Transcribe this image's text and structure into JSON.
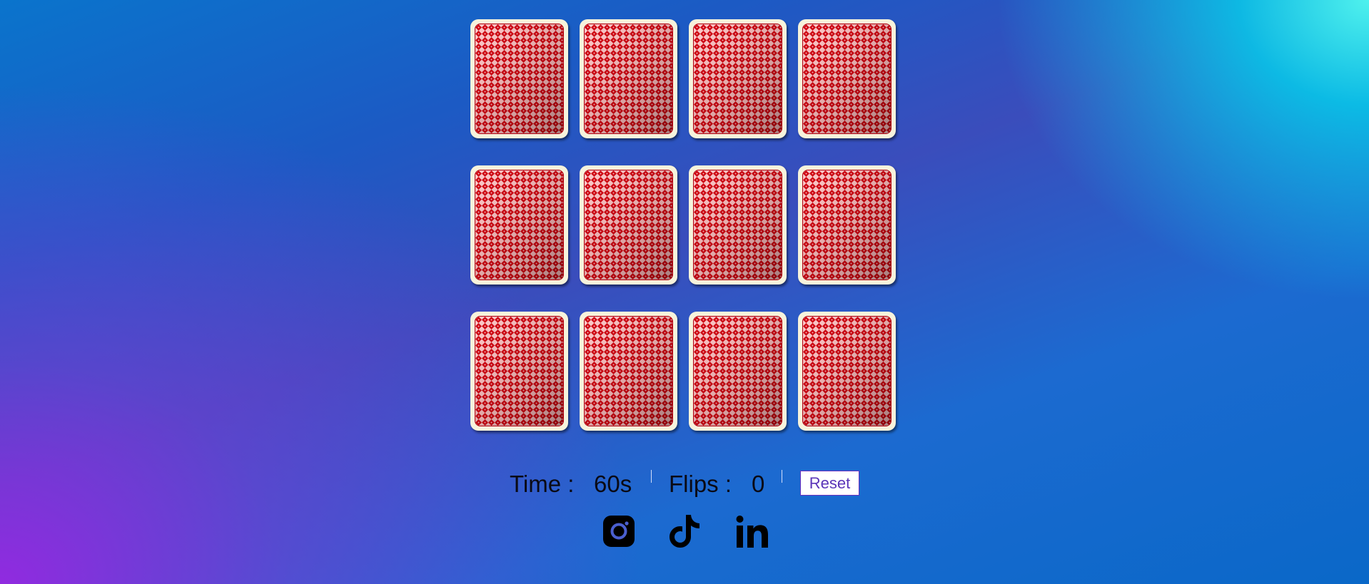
{
  "game": {
    "cards": [
      {
        "id": 1,
        "state": "face-down"
      },
      {
        "id": 2,
        "state": "face-down"
      },
      {
        "id": 3,
        "state": "face-down"
      },
      {
        "id": 4,
        "state": "face-down"
      },
      {
        "id": 5,
        "state": "face-down"
      },
      {
        "id": 6,
        "state": "face-down"
      },
      {
        "id": 7,
        "state": "face-down"
      },
      {
        "id": 8,
        "state": "face-down"
      },
      {
        "id": 9,
        "state": "face-down"
      },
      {
        "id": 10,
        "state": "face-down"
      },
      {
        "id": 11,
        "state": "face-down"
      },
      {
        "id": 12,
        "state": "face-down"
      }
    ],
    "card_back_icon": "diamond-pattern-card-back",
    "card_back_color": "#c8000f",
    "card_border_color": "#f7f3dc"
  },
  "stats": {
    "time_label": "Time :",
    "time_value": "60s",
    "flips_label": "Flips :",
    "flips_value": "0",
    "reset_label": "Reset"
  },
  "social": [
    {
      "name": "instagram",
      "icon": "instagram-icon"
    },
    {
      "name": "tiktok",
      "icon": "tiktok-icon"
    },
    {
      "name": "linkedin",
      "icon": "linkedin-icon"
    }
  ],
  "theme": {
    "gradient_top_right": "#3ff5f0",
    "gradient_center": "#1c5ac4",
    "gradient_bottom_left": "#9a28e0",
    "reset_text_color": "#5a35b8"
  }
}
